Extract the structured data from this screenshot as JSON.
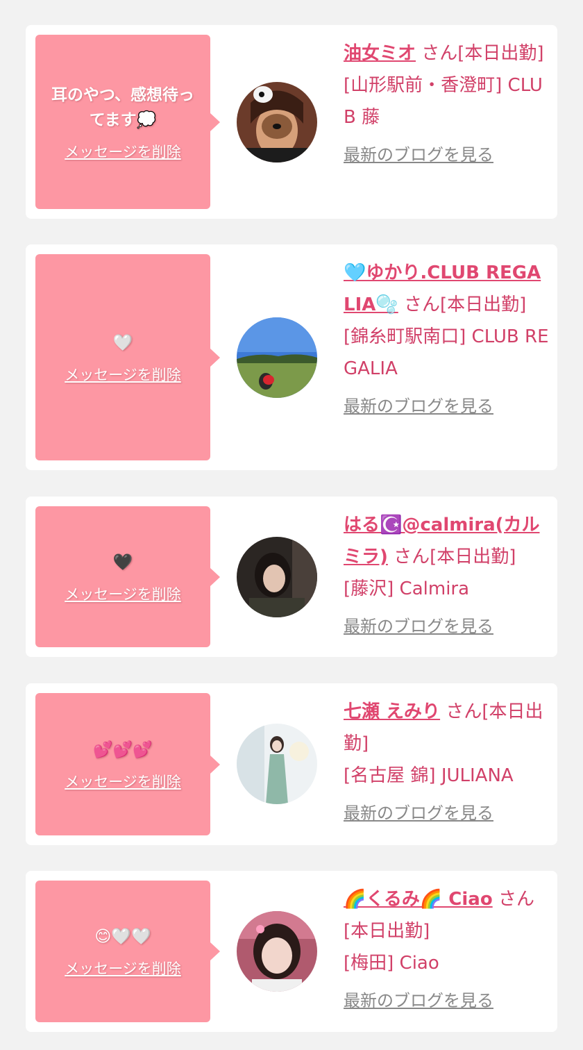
{
  "colors": {
    "bubble": "#fd97a3",
    "accent": "#e04770",
    "text": "#d14068",
    "link_gray": "#888888",
    "background": "#f2f2f2"
  },
  "cards": [
    {
      "message": "耳のやつ、感想待ってます💭",
      "delete_label": "メッセージを削除",
      "name": "油女ミオ",
      "suffix": " さん[本日出勤]",
      "shop": "[山形駅前・香澄町] CLUB 藤",
      "blog_label": "最新のブログを見る",
      "avatar_icon": "avatar-photo-dog-filter"
    },
    {
      "message": "🤍",
      "delete_label": "メッセージを削除",
      "name": "🩵ゆかり.CLUB REGALIA🫧",
      "suffix": " さん[本日出勤]",
      "shop": "[錦糸町駅南口] CLUB REGALIA",
      "blog_label": "最新のブログを見る",
      "avatar_icon": "avatar-photo-park"
    },
    {
      "message": "🖤",
      "delete_label": "メッセージを削除",
      "name": "はる☪️@calmira(カルミラ)",
      "suffix": " さん[本日出勤]",
      "shop": "[藤沢] Calmira",
      "blog_label": "最新のブログを見る",
      "avatar_icon": "avatar-photo-portrait"
    },
    {
      "message": "💕💕💕",
      "delete_label": "メッセージを削除",
      "name": "七瀬 えみり",
      "suffix": " さん[本日出勤]",
      "shop": "[名古屋 錦] JULIANA",
      "blog_label": "最新のブログを見る",
      "avatar_icon": "avatar-photo-dress"
    },
    {
      "message": "😊🤍🤍",
      "delete_label": "メッセージを削除",
      "name": "🌈くるみ🌈 Ciao",
      "suffix": " さん[本日出勤]",
      "shop": "[梅田] Ciao",
      "blog_label": "最新のブログを見る",
      "avatar_icon": "avatar-photo-selfie"
    }
  ]
}
